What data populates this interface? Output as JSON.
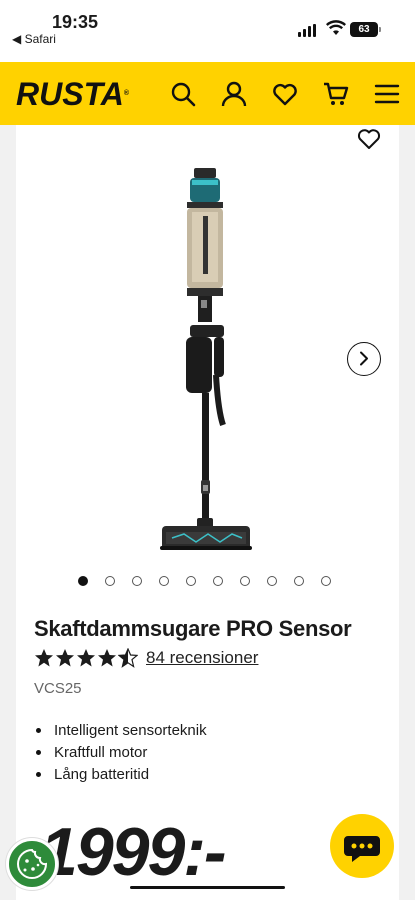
{
  "status_bar": {
    "time": "19:35",
    "back_label": "◀ Safari",
    "battery": "63"
  },
  "header": {
    "logo": "RUSTA",
    "brand_color": "#ffd200",
    "icons": [
      "search-icon",
      "account-icon",
      "heart-icon",
      "cart-icon",
      "menu-icon"
    ]
  },
  "gallery": {
    "image_count": 10,
    "active_index": 0,
    "favorite_icon": "heart-outline-icon",
    "next_icon": "chevron-right-icon"
  },
  "product": {
    "title": "Skaftdammsugare PRO Sensor",
    "rating": 4.5,
    "reviews_label": "84 recensioner",
    "sku": "VCS25",
    "features": [
      "Intelligent sensorteknik",
      "Kraftfull motor",
      "Lång batteritid"
    ],
    "price": "1999:-"
  },
  "floating": {
    "chat_icon": "chat-bubble-icon",
    "cookie_icon": "cookie-icon"
  }
}
